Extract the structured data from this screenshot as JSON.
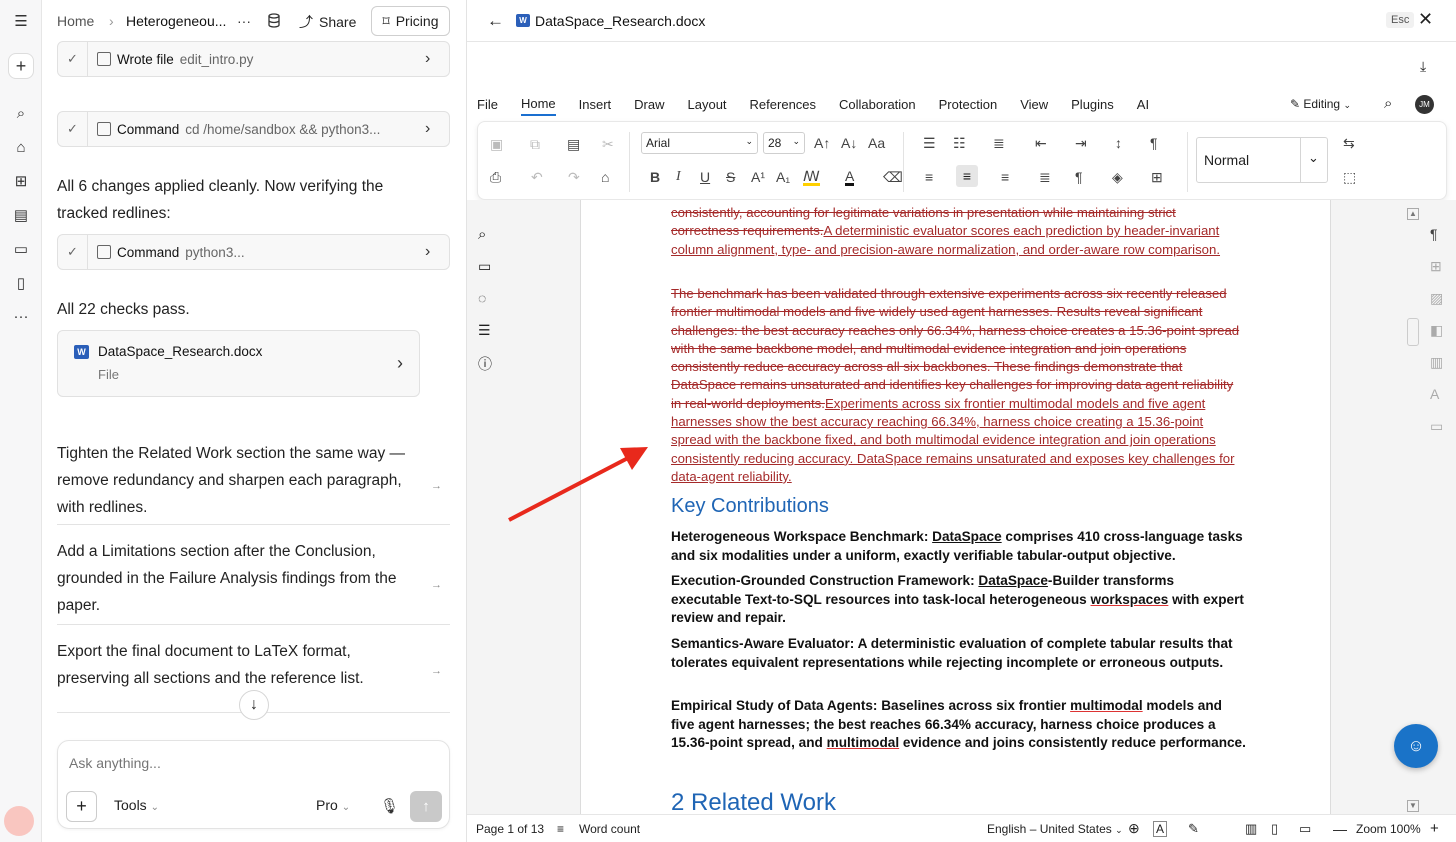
{
  "chat_header": {
    "home": "Home",
    "title": "Heterogeneou...",
    "more": "···",
    "share": "Share",
    "pricing": "Pricing"
  },
  "steps": [
    {
      "label": "Wrote file",
      "detail": "edit_intro.py"
    },
    {
      "label": "Command",
      "detail": "cd /home/sandbox && python3..."
    },
    {
      "label": "Command",
      "detail": "python3..."
    }
  ],
  "messages": {
    "applied": "All 6 changes applied cleanly. Now verifying the tracked redlines:",
    "checks": "All 22 checks pass."
  },
  "file_card": {
    "name": "DataSpace_Research.docx",
    "type": "File"
  },
  "suggestions": [
    "Tighten the Related Work section the same way — remove redundancy and sharpen each paragraph, with redlines.",
    "Add a Limitations section after the Conclusion, grounded in the Failure Analysis findings from the paper.",
    "Export the final document to LaTeX format, preserving all sections and the reference list."
  ],
  "input": {
    "placeholder": "Ask anything...",
    "tools": "Tools",
    "model": "Pro"
  },
  "viewer": {
    "filename": "DataSpace_Research.docx",
    "esc": "Esc",
    "menu": [
      "File",
      "Home",
      "Insert",
      "Draw",
      "Layout",
      "References",
      "Collaboration",
      "Protection",
      "View",
      "Plugins",
      "AI"
    ],
    "active_menu": "Home",
    "editing": "Editing",
    "avatar": "JM",
    "font": "Arial",
    "font_size": "28",
    "style": "Normal"
  },
  "document": {
    "p1_del_a": "consistently, accounting for legitimate variations in presentation while maintaining strict correctness requirements.",
    "p1_ins": "A deterministic evaluator scores each prediction by header-invariant column alignment, type- and precision-aware normalization, and order-aware row comparison.",
    "p2_del": "The benchmark has been validated through extensive experiments across six recently released frontier multimodal models and five widely used agent harnesses. Results reveal significant challenges: the best accuracy reaches only 66.34%, harness choice creates a 15.36-point spread with the same backbone model, and multimodal evidence integration and join operations consistently reduce accuracy across all six backbones. These findings demonstrate that DataSpace remains unsaturated and identifies key challenges for improving data agent reliability in real-world deployments.",
    "p2_ins": "Experiments across six frontier multimodal models and five agent harnesses show the best accuracy reaching 66.34%, harness choice creating a 15.36-point spread with the backbone fixed, and both multimodal evidence integration and join operations consistently reducing accuracy. DataSpace remains unsaturated and exposes key challenges for data-agent reliability.",
    "heading": "Key Contributions",
    "c1_title": "Heterogeneous Workspace Benchmark:",
    "c1_pre": " ",
    "c1_name": "DataSpace",
    "c1_text": " comprises 410 cross-language tasks and six modalities under a uniform, exactly verifiable tabular-output objective.",
    "c2_title": "Execution-Grounded Construction Framework:",
    "c2_name": "DataSpace",
    "c2_text_a": "-Builder transforms executable Text-to-SQL resources into task-local heterogeneous ",
    "c2_word": "workspaces",
    "c2_text_b": " with expert review and repair.",
    "c3": "Semantics-Aware Evaluator: A deterministic evaluation of complete tabular results that tolerates equivalent representations while rejecting incomplete or erroneous outputs.",
    "c4_a": "Empirical Study of Data Agents: Baselines across six frontier ",
    "c4_w1": "multimodal",
    "c4_b": " models and five agent harnesses; the best reaches 66.34% accuracy, harness choice produces a 15.36-point spread, and ",
    "c4_w2": "multimodal",
    "c4_c": " evidence and joins consistently reduce performance.",
    "next_heading": "2  Related Work"
  },
  "status": {
    "page": "Page 1 of 13",
    "word_count": "Word count",
    "language": "English – United States",
    "zoom": "Zoom 100%"
  },
  "colors": {
    "redline": "#a52a2a",
    "heading": "#1f65b5",
    "arrow": "#e8291c",
    "fab": "#1a73c8"
  }
}
